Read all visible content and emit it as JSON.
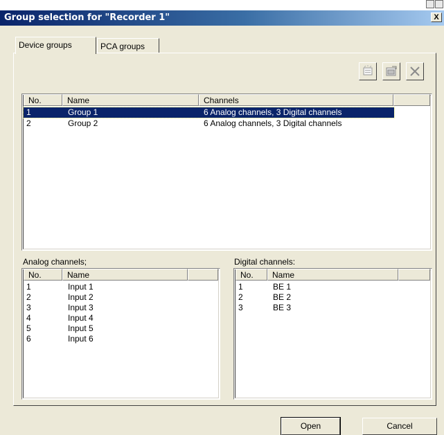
{
  "dialog": {
    "title": "Group selection for \"Recorder 1\"",
    "close_label": "X"
  },
  "tabs": [
    {
      "label": "Device groups",
      "active": true
    },
    {
      "label": "PCA groups",
      "active": false
    }
  ],
  "toolbar": {
    "icons": [
      "new-group-icon",
      "edit-group-icon",
      "delete-icon"
    ]
  },
  "groups_table": {
    "columns": [
      "No.",
      "Name",
      "Channels"
    ],
    "rows": [
      {
        "no": "1",
        "name": "Group 1",
        "channels": "6 Analog channels, 3 Digital channels",
        "selected": true
      },
      {
        "no": "2",
        "name": "Group 2",
        "channels": "6 Analog channels, 3 Digital channels",
        "selected": false
      }
    ]
  },
  "analog": {
    "label": "Analog channels;",
    "columns": [
      "No.",
      "Name"
    ],
    "rows": [
      {
        "no": "1",
        "name": "Input 1"
      },
      {
        "no": "2",
        "name": "Input 2"
      },
      {
        "no": "3",
        "name": "Input 3"
      },
      {
        "no": "4",
        "name": "Input 4"
      },
      {
        "no": "5",
        "name": "Input 5"
      },
      {
        "no": "6",
        "name": "Input 6"
      }
    ]
  },
  "digital": {
    "label": "Digital channels:",
    "columns": [
      "No.",
      "Name"
    ],
    "rows": [
      {
        "no": "1",
        "name": "BE 1"
      },
      {
        "no": "2",
        "name": "BE 2"
      },
      {
        "no": "3",
        "name": "BE 3"
      }
    ]
  },
  "buttons": {
    "open": "Open",
    "cancel": "Cancel"
  },
  "colors": {
    "title_bar": "#0a246a",
    "selection": "#0a246a",
    "dialog_face": "#ece9d8"
  }
}
